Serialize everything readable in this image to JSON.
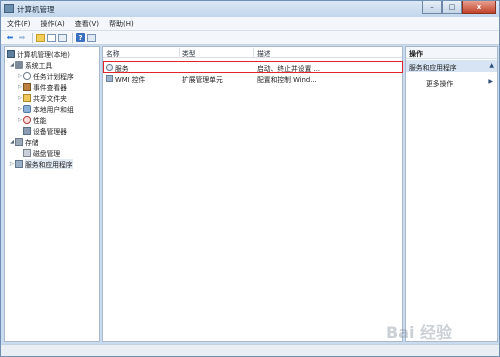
{
  "window": {
    "title": "计算机管理",
    "controls": {
      "minimize": "–",
      "maximize": "□",
      "close": "x"
    }
  },
  "menu": [
    "文件(F)",
    "操作(A)",
    "查看(V)",
    "帮助(H)"
  ],
  "toolbar": {
    "icons": [
      "back-arrow-icon",
      "forward-arrow-icon",
      "up-folder-icon",
      "show-tree-icon",
      "properties-icon",
      "help-icon",
      "show-action-pane-icon"
    ],
    "back": "⬅",
    "forward": "➡",
    "help": "?"
  },
  "tree": {
    "root": "计算机管理(本地)",
    "items": [
      {
        "label": "系统工具",
        "icon": "tools-icon",
        "expander": "◢"
      },
      {
        "label": "任务计划程序",
        "icon": "clock-icon",
        "expander": "▷"
      },
      {
        "label": "事件查看器",
        "icon": "event-log-icon",
        "expander": "▷"
      },
      {
        "label": "共享文件夹",
        "icon": "folder-icon",
        "expander": "▷"
      },
      {
        "label": "本地用户和组",
        "icon": "users-icon",
        "expander": "▷"
      },
      {
        "label": "性能",
        "icon": "performance-icon",
        "expander": "▷"
      },
      {
        "label": "设备管理器",
        "icon": "device-manager-icon",
        "expander": ""
      },
      {
        "label": "存储",
        "icon": "storage-icon",
        "expander": "◢"
      },
      {
        "label": "磁盘管理",
        "icon": "disk-icon",
        "expander": ""
      },
      {
        "label": "服务和应用程序",
        "icon": "services-apps-icon",
        "expander": "▷"
      }
    ]
  },
  "list": {
    "columns": [
      "名称",
      "类型",
      "描述"
    ],
    "rows": [
      {
        "name": "服务",
        "type": "",
        "desc": "启动、终止并设置 ...",
        "icon": "gear-icon"
      },
      {
        "name": "WMI 控件",
        "type": "扩展管理单元",
        "desc": "配置和控制 Wind...",
        "icon": "wmi-icon"
      }
    ]
  },
  "actions": {
    "title": "操作",
    "section": "服务和应用程序",
    "collapse": "▲",
    "items": [
      {
        "label": "更多操作",
        "arrow": "▶"
      }
    ]
  },
  "watermark": "Bai 经验",
  "colors": {
    "highlight": "#e0262a",
    "selection": "#d6e4f3",
    "frame": "#c9dcef"
  }
}
